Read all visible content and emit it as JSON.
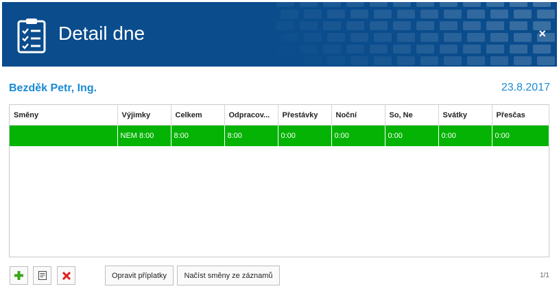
{
  "header": {
    "title": "Detail dne",
    "close_label": "×"
  },
  "info": {
    "person": "Bezděk Petr, Ing.",
    "date": "23.8.2017"
  },
  "grid": {
    "columns": [
      "Směny",
      "Výjimky",
      "Celkem",
      "Odpracov...",
      "Přestávky",
      "Noční",
      "So, Ne",
      "Svátky",
      "Přesčas"
    ],
    "rows": [
      [
        "",
        "NEM 8:00",
        "8:00",
        "8:00",
        "0:00",
        "0:00",
        "0:00",
        "0:00",
        "0:00"
      ]
    ]
  },
  "footer": {
    "fix_label": "Opravit příplatky",
    "load_label": "Načíst směny ze záznamů",
    "pager": "1/1"
  },
  "colors": {
    "header_bg": "#0a4c8c",
    "accent": "#1a8ad4",
    "row_selected": "#04b304"
  },
  "icons": {
    "header": "clipboard-checklist-icon",
    "add": "plus-icon",
    "edit": "note-icon",
    "delete": "x-icon"
  }
}
